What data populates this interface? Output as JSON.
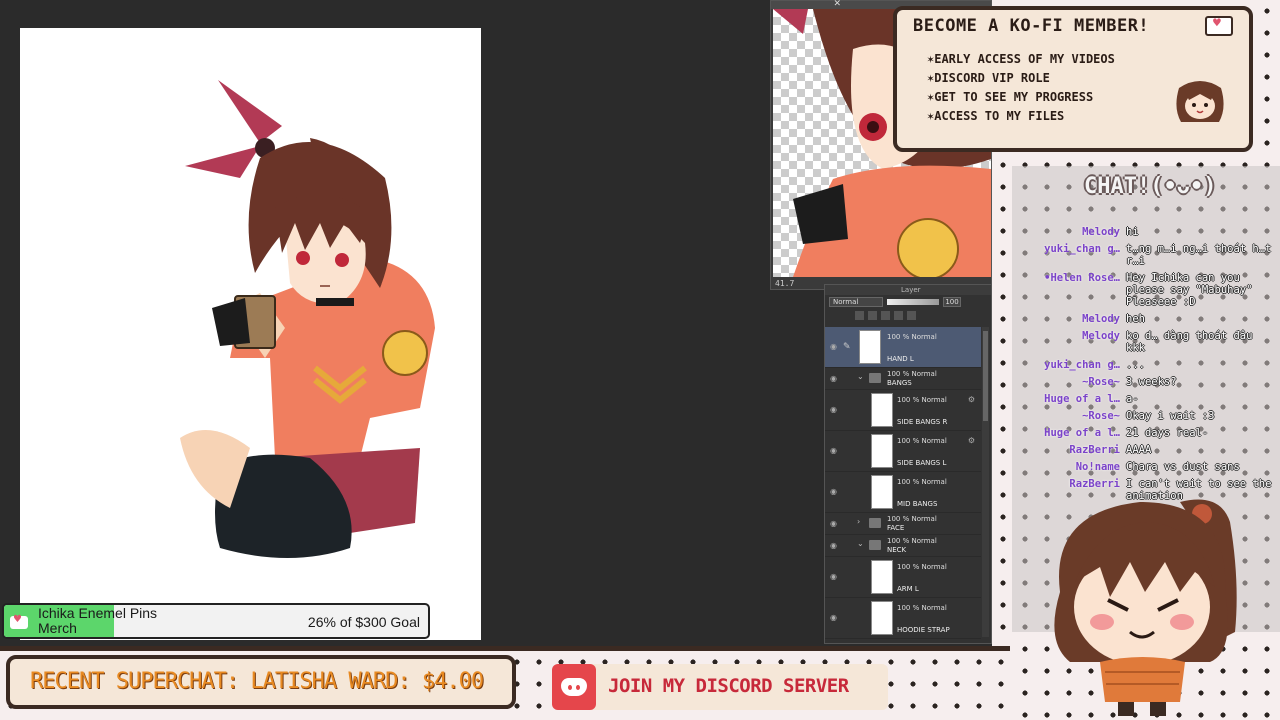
{
  "preview": {
    "zoom": "41.7"
  },
  "layer_panel": {
    "title": "Layer",
    "blend_mode": "Normal",
    "opacity": "100",
    "layers": [
      {
        "type": "layer",
        "meta": "100 % Normal",
        "name": "HAND L",
        "selected": true
      },
      {
        "type": "folder",
        "meta": "100 % Normal",
        "name": "BANGS"
      },
      {
        "type": "layer",
        "meta": "100 % Normal",
        "name": "SIDE BANGS R"
      },
      {
        "type": "layer",
        "meta": "100 % Normal",
        "name": "SIDE BANGS L"
      },
      {
        "type": "layer",
        "meta": "100 % Normal",
        "name": "MID BANGS"
      },
      {
        "type": "folder",
        "meta": "100 % Normal",
        "name": "FACE"
      },
      {
        "type": "folder",
        "meta": "100 % Normal",
        "name": "NECK"
      },
      {
        "type": "layer",
        "meta": "100 % Normal",
        "name": "ARM L"
      },
      {
        "type": "layer",
        "meta": "100 % Normal",
        "name": "HOODIE STRAP"
      }
    ]
  },
  "kofi": {
    "title": "BECOME A KO-FI MEMBER!",
    "perks": [
      "EARLY ACCESS OF MY VIDEOS",
      "DISCORD VIP ROLE",
      "GET TO SEE MY PROGRESS",
      "ACCESS TO MY FILES"
    ]
  },
  "chat": {
    "title": "CHAT!(•ᴗ•)",
    "messages": [
      {
        "user": "Melody",
        "text": "hi"
      },
      {
        "user": "yuki_chan g…",
        "text": "t…ng m…i ng…i thoát h…t r…i"
      },
      {
        "user": "•Helen Rose…",
        "text": "Hey Ichika can you please say \"Mabuhay\" Pleaseee :D"
      },
      {
        "user": "Melody",
        "text": "heh"
      },
      {
        "user": "Melody",
        "text": "ko d… dàng thoát đâu kkk"
      },
      {
        "user": "yuki_chan g…",
        "text": "..."
      },
      {
        "user": "~Rose~",
        "text": "3 weeks?"
      },
      {
        "user": "Huge of a l…",
        "text": "a-"
      },
      {
        "user": "~Rose~",
        "text": "Okay i wait :3"
      },
      {
        "user": "Huge of a l…",
        "text": "21 days real-"
      },
      {
        "user": "RazBerri",
        "text": "AAAA"
      },
      {
        "user": "No!name",
        "text": "Chara vs dust sans"
      },
      {
        "user": "RazBerri",
        "text": "I can't wait to see the animation"
      }
    ]
  },
  "goal": {
    "title": "Ichika Enemel Pins Merch",
    "progress_text": "26% of $300 Goal",
    "progress_percent": 26,
    "color": "#5cd66b"
  },
  "superchat": {
    "text": "RECENT SUPERCHAT: LATISHA WARD: $4.00"
  },
  "discord": {
    "text": "JOIN MY DISCORD SERVER"
  }
}
